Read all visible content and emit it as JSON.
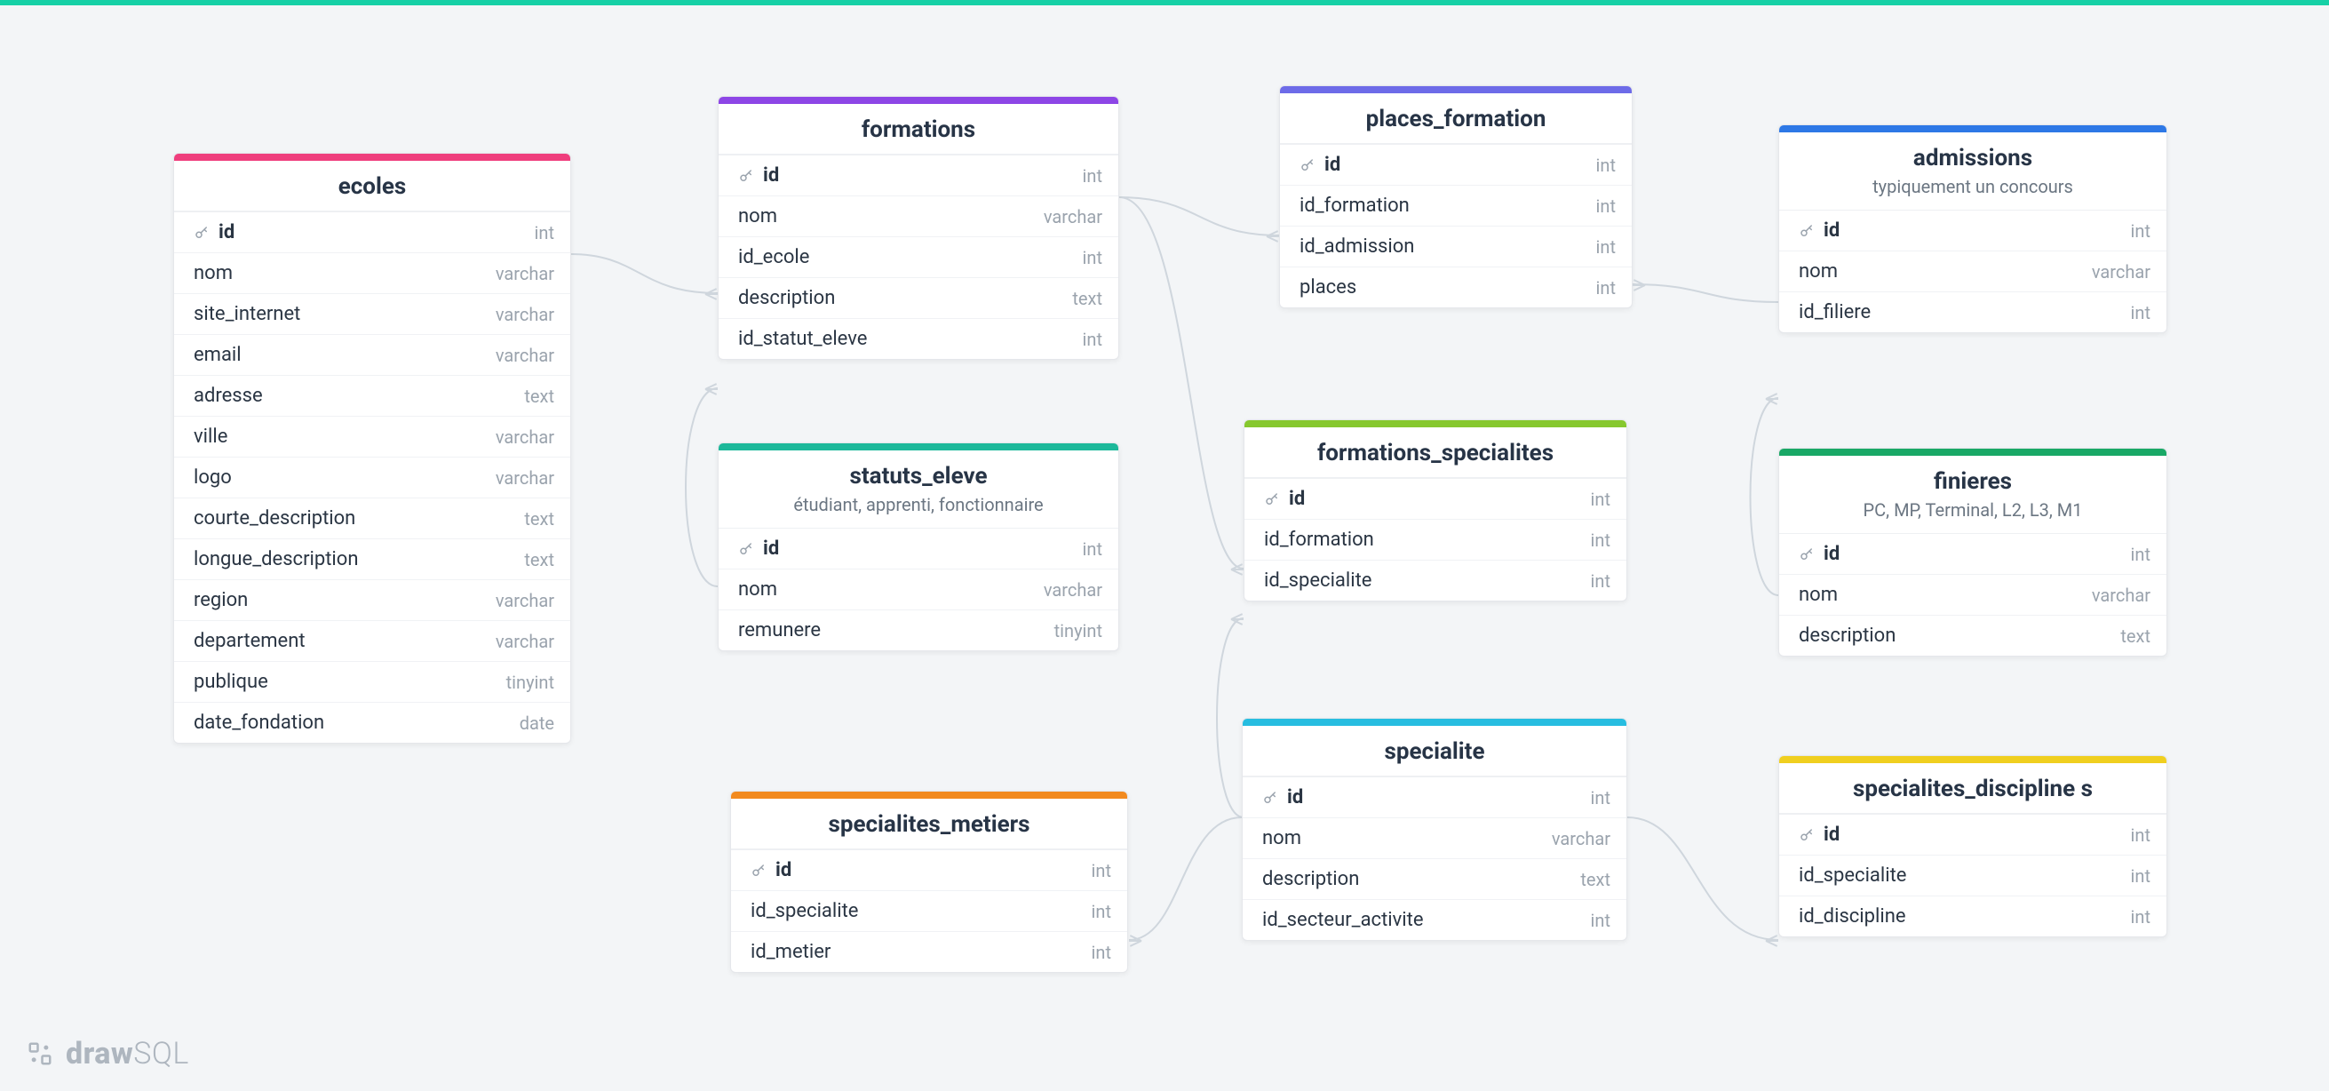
{
  "brand": {
    "part1": "draw",
    "part2": "SQL"
  },
  "tables": {
    "ecoles": {
      "title": "ecoles",
      "color": "#ef3e7d",
      "columns": [
        {
          "name": "id",
          "type": "int",
          "pk": true
        },
        {
          "name": "nom",
          "type": "varchar"
        },
        {
          "name": "site_internet",
          "type": "varchar"
        },
        {
          "name": "email",
          "type": "varchar"
        },
        {
          "name": "adresse",
          "type": "text"
        },
        {
          "name": "ville",
          "type": "varchar"
        },
        {
          "name": "logo",
          "type": "varchar"
        },
        {
          "name": "courte_description",
          "type": "text"
        },
        {
          "name": "longue_description",
          "type": "text"
        },
        {
          "name": "region",
          "type": "varchar"
        },
        {
          "name": "departement",
          "type": "varchar"
        },
        {
          "name": "publique",
          "type": "tinyint"
        },
        {
          "name": "date_fondation",
          "type": "date"
        }
      ]
    },
    "formations": {
      "title": "formations",
      "color": "#8d46e6",
      "columns": [
        {
          "name": "id",
          "type": "int",
          "pk": true
        },
        {
          "name": "nom",
          "type": "varchar"
        },
        {
          "name": "id_ecole",
          "type": "int"
        },
        {
          "name": "description",
          "type": "text"
        },
        {
          "name": "id_statut_eleve",
          "type": "int"
        }
      ]
    },
    "places_formation": {
      "title": "places_formation",
      "color": "#6d6be8",
      "columns": [
        {
          "name": "id",
          "type": "int",
          "pk": true
        },
        {
          "name": "id_formation",
          "type": "int"
        },
        {
          "name": "id_admission",
          "type": "int"
        },
        {
          "name": "places",
          "type": "int"
        }
      ]
    },
    "admissions": {
      "title": "admissions",
      "subtitle": "typiquement un concours",
      "color": "#2d78e6",
      "columns": [
        {
          "name": "id",
          "type": "int",
          "pk": true
        },
        {
          "name": "nom",
          "type": "varchar"
        },
        {
          "name": "id_filiere",
          "type": "int"
        }
      ]
    },
    "statuts_eleve": {
      "title": "statuts_eleve",
      "subtitle": "étudiant, apprenti, fonctionnaire",
      "color": "#1cb89a",
      "columns": [
        {
          "name": "id",
          "type": "int",
          "pk": true
        },
        {
          "name": "nom",
          "type": "varchar"
        },
        {
          "name": "remunere",
          "type": "tinyint"
        }
      ]
    },
    "formations_specialites": {
      "title": "formations_specialites",
      "color": "#86c82e",
      "columns": [
        {
          "name": "id",
          "type": "int",
          "pk": true
        },
        {
          "name": "id_formation",
          "type": "int"
        },
        {
          "name": "id_specialite",
          "type": "int"
        }
      ]
    },
    "finieres": {
      "title": "finieres",
      "subtitle": "PC, MP, Terminal, L2, L3, M1",
      "color": "#19a866",
      "columns": [
        {
          "name": "id",
          "type": "int",
          "pk": true
        },
        {
          "name": "nom",
          "type": "varchar"
        },
        {
          "name": "description",
          "type": "text"
        }
      ]
    },
    "specialite": {
      "title": "specialite",
      "color": "#27bde0",
      "columns": [
        {
          "name": "id",
          "type": "int",
          "pk": true
        },
        {
          "name": "nom",
          "type": "varchar"
        },
        {
          "name": "description",
          "type": "text"
        },
        {
          "name": "id_secteur_activite",
          "type": "int"
        }
      ]
    },
    "specialites_metiers": {
      "title": "specialites_metiers",
      "color": "#f28a1f",
      "columns": [
        {
          "name": "id",
          "type": "int",
          "pk": true
        },
        {
          "name": "id_specialite",
          "type": "int"
        },
        {
          "name": "id_metier",
          "type": "int"
        }
      ]
    },
    "specialites_disciplines": {
      "title": "specialites_discipline s",
      "color": "#f0cf1f",
      "columns": [
        {
          "name": "id",
          "type": "int",
          "pk": true
        },
        {
          "name": "id_specialite",
          "type": "int"
        },
        {
          "name": "id_discipline",
          "type": "int"
        }
      ]
    }
  }
}
